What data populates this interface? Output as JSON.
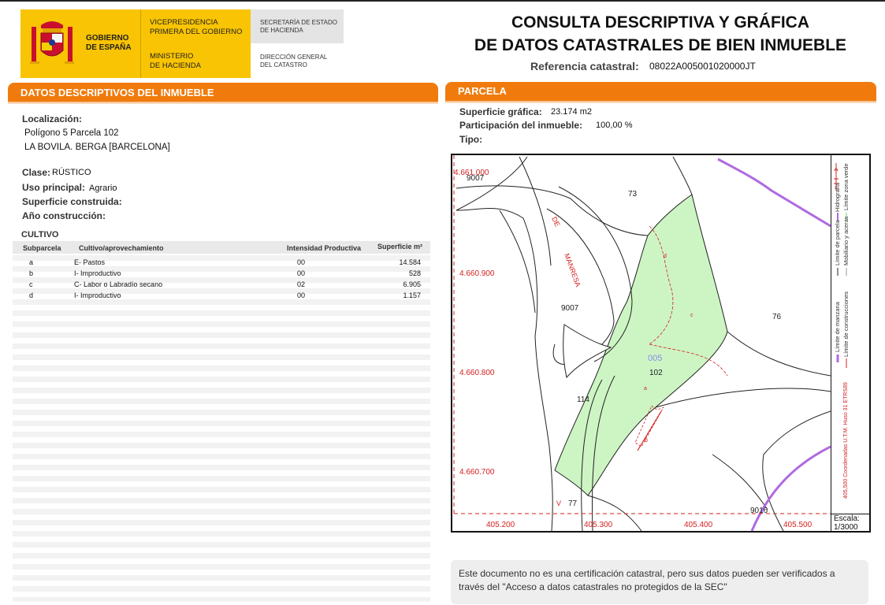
{
  "header": {
    "gobierno": "GOBIERNO\nDE ESPAÑA",
    "vicepresidencia": "VICEPRESIDENCIA\nPRIMERA DEL GOBIERNO",
    "ministerio": "MINISTERIO\nDE HACIENDA",
    "secretaria": "SECRETARÍA DE ESTADO\nDE HACIENDA",
    "direccion": "DIRECCIÓN GENERAL\nDEL CATASTRO",
    "title_line1": "CONSULTA DESCRIPTIVA Y GRÁFICA",
    "title_line2": "DE DATOS CATASTRALES DE BIEN INMUEBLE",
    "ref_label": "Referencia catastral:",
    "ref_value": "08022A005001020000JT"
  },
  "datos": {
    "section_title": "DATOS DESCRIPTIVOS DEL INMUEBLE",
    "localizacion_label": "Localización:",
    "localizacion_line1": "Polígono 5 Parcela 102",
    "localizacion_line2": "LA BOVILA. BERGA [BARCELONA]",
    "clase_label": "Clase:",
    "clase_value": "RÚSTICO",
    "uso_label": "Uso principal:",
    "uso_value": "Agrario",
    "superficie_label": "Superficie construida:",
    "anio_label": "Año construcción:",
    "cultivo_title": "CULTIVO",
    "table_headers": {
      "subparcela": "Subparcela",
      "cultivo": "Cultivo/aprovechamiento",
      "intensidad": "Intensidad Productiva",
      "superficie": "Superficie m²"
    },
    "rows": [
      {
        "sub": "a",
        "cultivo": "E- Pastos",
        "intensidad": "00",
        "superficie": "14.584"
      },
      {
        "sub": "b",
        "cultivo": "I- Improductivo",
        "intensidad": "00",
        "superficie": "528"
      },
      {
        "sub": "c",
        "cultivo": "C- Labor o Labradío secano",
        "intensidad": "02",
        "superficie": "6.905"
      },
      {
        "sub": "d",
        "cultivo": "I- Improductivo",
        "intensidad": "00",
        "superficie": "1.157"
      }
    ]
  },
  "parcela": {
    "section_title": "PARCELA",
    "superficie_label": "Superficie gráfica:",
    "superficie_value": "23.174 m2",
    "participacion_label": "Participación del inmueble:",
    "participacion_value": "100,00 %",
    "tipo_label": "Tipo:"
  },
  "map": {
    "y_labels": [
      "4.661.000",
      "4.660.900",
      "4.660.800",
      "4.660.700"
    ],
    "x_labels": [
      "405.200",
      "405.300",
      "405.400",
      "405.500"
    ],
    "parcel_labels": [
      "9007",
      "73",
      "9007",
      "76",
      "005",
      "102",
      "114",
      "77",
      "9016"
    ],
    "sub_labels": [
      "d",
      "c",
      "a",
      "b"
    ],
    "street_labels": [
      "DE",
      "MANRESA",
      "V"
    ],
    "legend": {
      "limite_manzana": "Límite de manzana",
      "limite_parcela": "Límite de parcela",
      "hidrografia": "Hidrografía",
      "limite_construcciones": "Límite de construcciones",
      "mobiliario": "Mobiliario y aceras",
      "zona_verde": "Límite zona verde",
      "coordenadas": "405,500 Coordenadas U.T.M. Huso 31 ETRS89"
    },
    "escala_label": "Escala:",
    "escala_value": "1/3000",
    "colors": {
      "parcel_fill": "#cdf5c4",
      "coords": "#d42020",
      "hidro": "#b06ae0"
    }
  },
  "notice": {
    "text": "Este documento no es una certificación catastral, pero sus datos pueden ser verificados a través del \"Acceso a datos catastrales no protegidos de la SEC\""
  }
}
